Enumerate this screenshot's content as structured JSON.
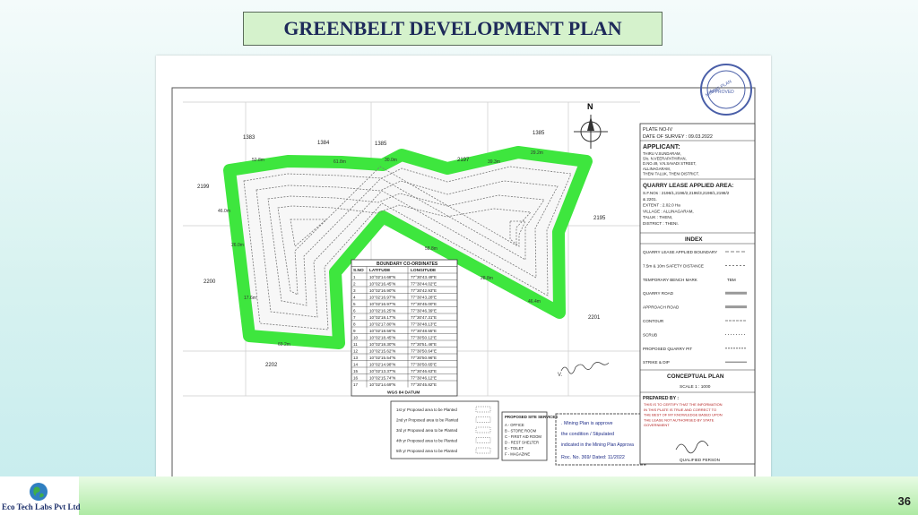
{
  "title": "GREENBELT DEVELOPMENT PLAN",
  "page_number": "36",
  "company": "Eco Tech Labs Pvt Ltd",
  "colors": {
    "greenbelt": "#3ee63e",
    "title_bg": "#d5f2cc",
    "title_text": "#1e2a5a"
  },
  "plan": {
    "north": "N",
    "survey_numbers": [
      "1383",
      "1384",
      "1385",
      "1385",
      "2197",
      "2199",
      "2195",
      "2200",
      "2201",
      "2202"
    ],
    "side_lengths": [
      "52.8m",
      "61.8m",
      "30.0m",
      "39.3m",
      "29.2m",
      "46.0m",
      "26.0m",
      "17.6m",
      "69.2m",
      "58.8m",
      "28.8m",
      "46.4m"
    ],
    "plate": {
      "plate_no": "PLATE NO-IV",
      "date": "DATE OF SURVEY : 09.03.2022"
    },
    "applicant": {
      "heading": "APPLICANT:",
      "lines": [
        "THIRU V.SUNDARAM,",
        "S/o. N.VEERAPATHIRAN,",
        "D.NO.49, V.N.SAVADI STREET,",
        "ALLINAGARAM,",
        "THENI TALUK, THENI DISTRICT."
      ]
    },
    "quarry_area": {
      "heading": "QUARRY LEASE APPLIED AREA:",
      "lines": [
        "S.F.NOs : 2196/1,2196/2,2196/3,2198/1,2198/2",
        "& 2201.",
        "EXTENT : 2.02.0 Ha",
        "VILLAGE : ALLINAGARAM,",
        "TALUK : THENI,",
        "DISTRICT : THENI."
      ]
    },
    "index": {
      "heading": "INDEX",
      "items": [
        "QUARRY LEASE APPLIED BOUNDARY",
        "7.5m & 10m SAFETY DISTANCE",
        "TEMPORARY BENCH MARK",
        "QUARRY ROAD",
        "APPROACH ROAD",
        "CONTOUR",
        "SCRUB",
        "PROPOSED QUARRY PIT",
        "STRIKE & DIP"
      ],
      "tbm": "TBM"
    },
    "conceptual": {
      "heading": "CONCEPTUAL PLAN",
      "scale": "SCALE 1 : 1000"
    },
    "prepared": {
      "heading": "PREPARED BY :",
      "text": [
        "THIS IS TO CERTIFY THAT THE INFORMATION",
        "IN THIS PLATE IS TRUE AND CORRECT TO",
        "THE BEST OF MY KNOWLEDGE BASED UPON",
        "THE LEASE NOT AUTHORISED BY STATE",
        "GOVERNMENT"
      ],
      "qualified": "QUALIFIED PERSON"
    },
    "boundary": {
      "heading": "BOUNDARY CO-ORDINATES",
      "columns": [
        "S.NO",
        "LATITUDE",
        "LONGITUDE"
      ],
      "rows": [
        [
          "1",
          "10°02'14.68\"N",
          "77°30'43.49\"E"
        ],
        [
          "2",
          "10°02'16.45\"N",
          "77°30'44.02\"E"
        ],
        [
          "3",
          "10°02'16.90\"N",
          "77°30'42.93\"E"
        ],
        [
          "4",
          "10°02'16.97\"N",
          "77°30'43.28\"E"
        ],
        [
          "5",
          "10°02'16.97\"N",
          "77°30'45.00\"E"
        ],
        [
          "6",
          "10°02'16.25\"N",
          "77°30'46.39\"E"
        ],
        [
          "7",
          "10°02'18.17\"N",
          "77°30'47.31\"E"
        ],
        [
          "8",
          "10°02'17.80\"N",
          "77°30'48.13\"E"
        ],
        [
          "9",
          "10°02'18.56\"N",
          "77°30'48.55\"E"
        ],
        [
          "10",
          "10°02'18.45\"N",
          "77°30'50.12\"E"
        ],
        [
          "11",
          "10°02'18.30\"N",
          "77°30'51.46\"E"
        ],
        [
          "12",
          "10°02'15.62\"N",
          "77°30'50.64\"E"
        ],
        [
          "13",
          "10°02'15.54\"N",
          "77°30'50.96\"E"
        ],
        [
          "14",
          "10°02'14.98\"N",
          "77°30'50.65\"E"
        ],
        [
          "15",
          "10°02'13.37\"N",
          "77°30'46.63\"E"
        ],
        [
          "16",
          "10°02'15.74\"N",
          "77°30'46.12\"E"
        ],
        [
          "17",
          "10°02'14.69\"N",
          "77°30'45.82\"E"
        ]
      ],
      "datum": "WGS 84 DATUM"
    },
    "legend": [
      "1st yr Proposed area to be Planted",
      "2nd yr Proposed area to be Planted",
      "3rd yr Proposed area to be Planted",
      "4th yr Proposed area to be Planted",
      "5th yr Proposed area to be Planted"
    ],
    "site": {
      "heading": "PROPOSED SITE SERVICES",
      "items": [
        "A - OFFICE",
        "B - STORE ROOM",
        "C - FIRST AID ROOM",
        "D - REST SHELTER",
        "E - TOILET",
        "F - MAGAZINE"
      ]
    },
    "stamp_text": [
      ". Mining Plan is approve",
      "the condition / Stipulated",
      "indicated in the Mining Plan Approva",
      "Roc. No. 369/ Dated: 11/2022"
    ],
    "seal_text": "MINING PLAN APPROVED"
  }
}
